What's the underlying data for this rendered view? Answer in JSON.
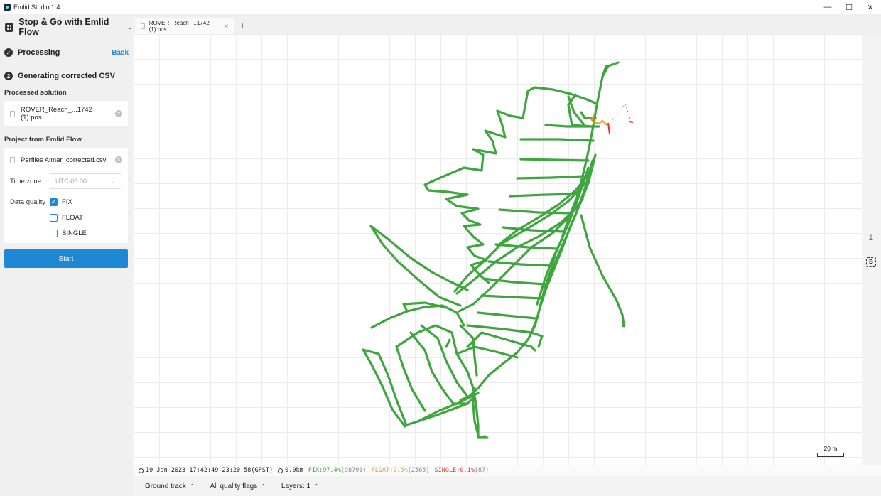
{
  "window": {
    "title": "Emlid Studio 1.4",
    "controls": [
      "—",
      "☐",
      "✕"
    ]
  },
  "sidebar": {
    "flow_title": "Stop & Go with Emlid Flow",
    "steps": [
      {
        "label": "Processing",
        "icon": "check",
        "action": "Back"
      },
      {
        "label": "Generating corrected CSV",
        "icon": "2"
      }
    ],
    "processed_solution": {
      "label": "Processed solution",
      "file": "ROVER_Reach_...1742 (1).pos"
    },
    "project": {
      "label": "Project from Emlid Flow",
      "file": "Perfiles Almar_corrected.csv",
      "timezone_label": "Time zone",
      "timezone_value": "UTC-05:00",
      "quality_label": "Data quality",
      "quality_options": [
        {
          "label": "FIX",
          "checked": true
        },
        {
          "label": "FLOAT",
          "checked": false
        },
        {
          "label": "SINGLE",
          "checked": false
        }
      ]
    },
    "start_label": "Start"
  },
  "tabs": [
    {
      "label": "ROVER_Reach_...1742 (1).pos"
    }
  ],
  "map": {
    "scale_label": "20 m",
    "track_color": "#3fa63f",
    "float_color": "#f0a020",
    "single_color": "#e53935"
  },
  "status": {
    "date": "19 Jan 2023 17:42:49-23:20:58(GPST)",
    "distance": "0.0km",
    "fix": "FIX:97.4%",
    "fix_count": "(98793)",
    "float": "FLOAT:2.5%",
    "float_count": "(2565)",
    "single": "SINGLE:0.1%",
    "single_count": "(87)"
  },
  "bottom": {
    "ground_track": "Ground track",
    "quality_flags": "All quality flags",
    "layers": "Layers: 1"
  }
}
